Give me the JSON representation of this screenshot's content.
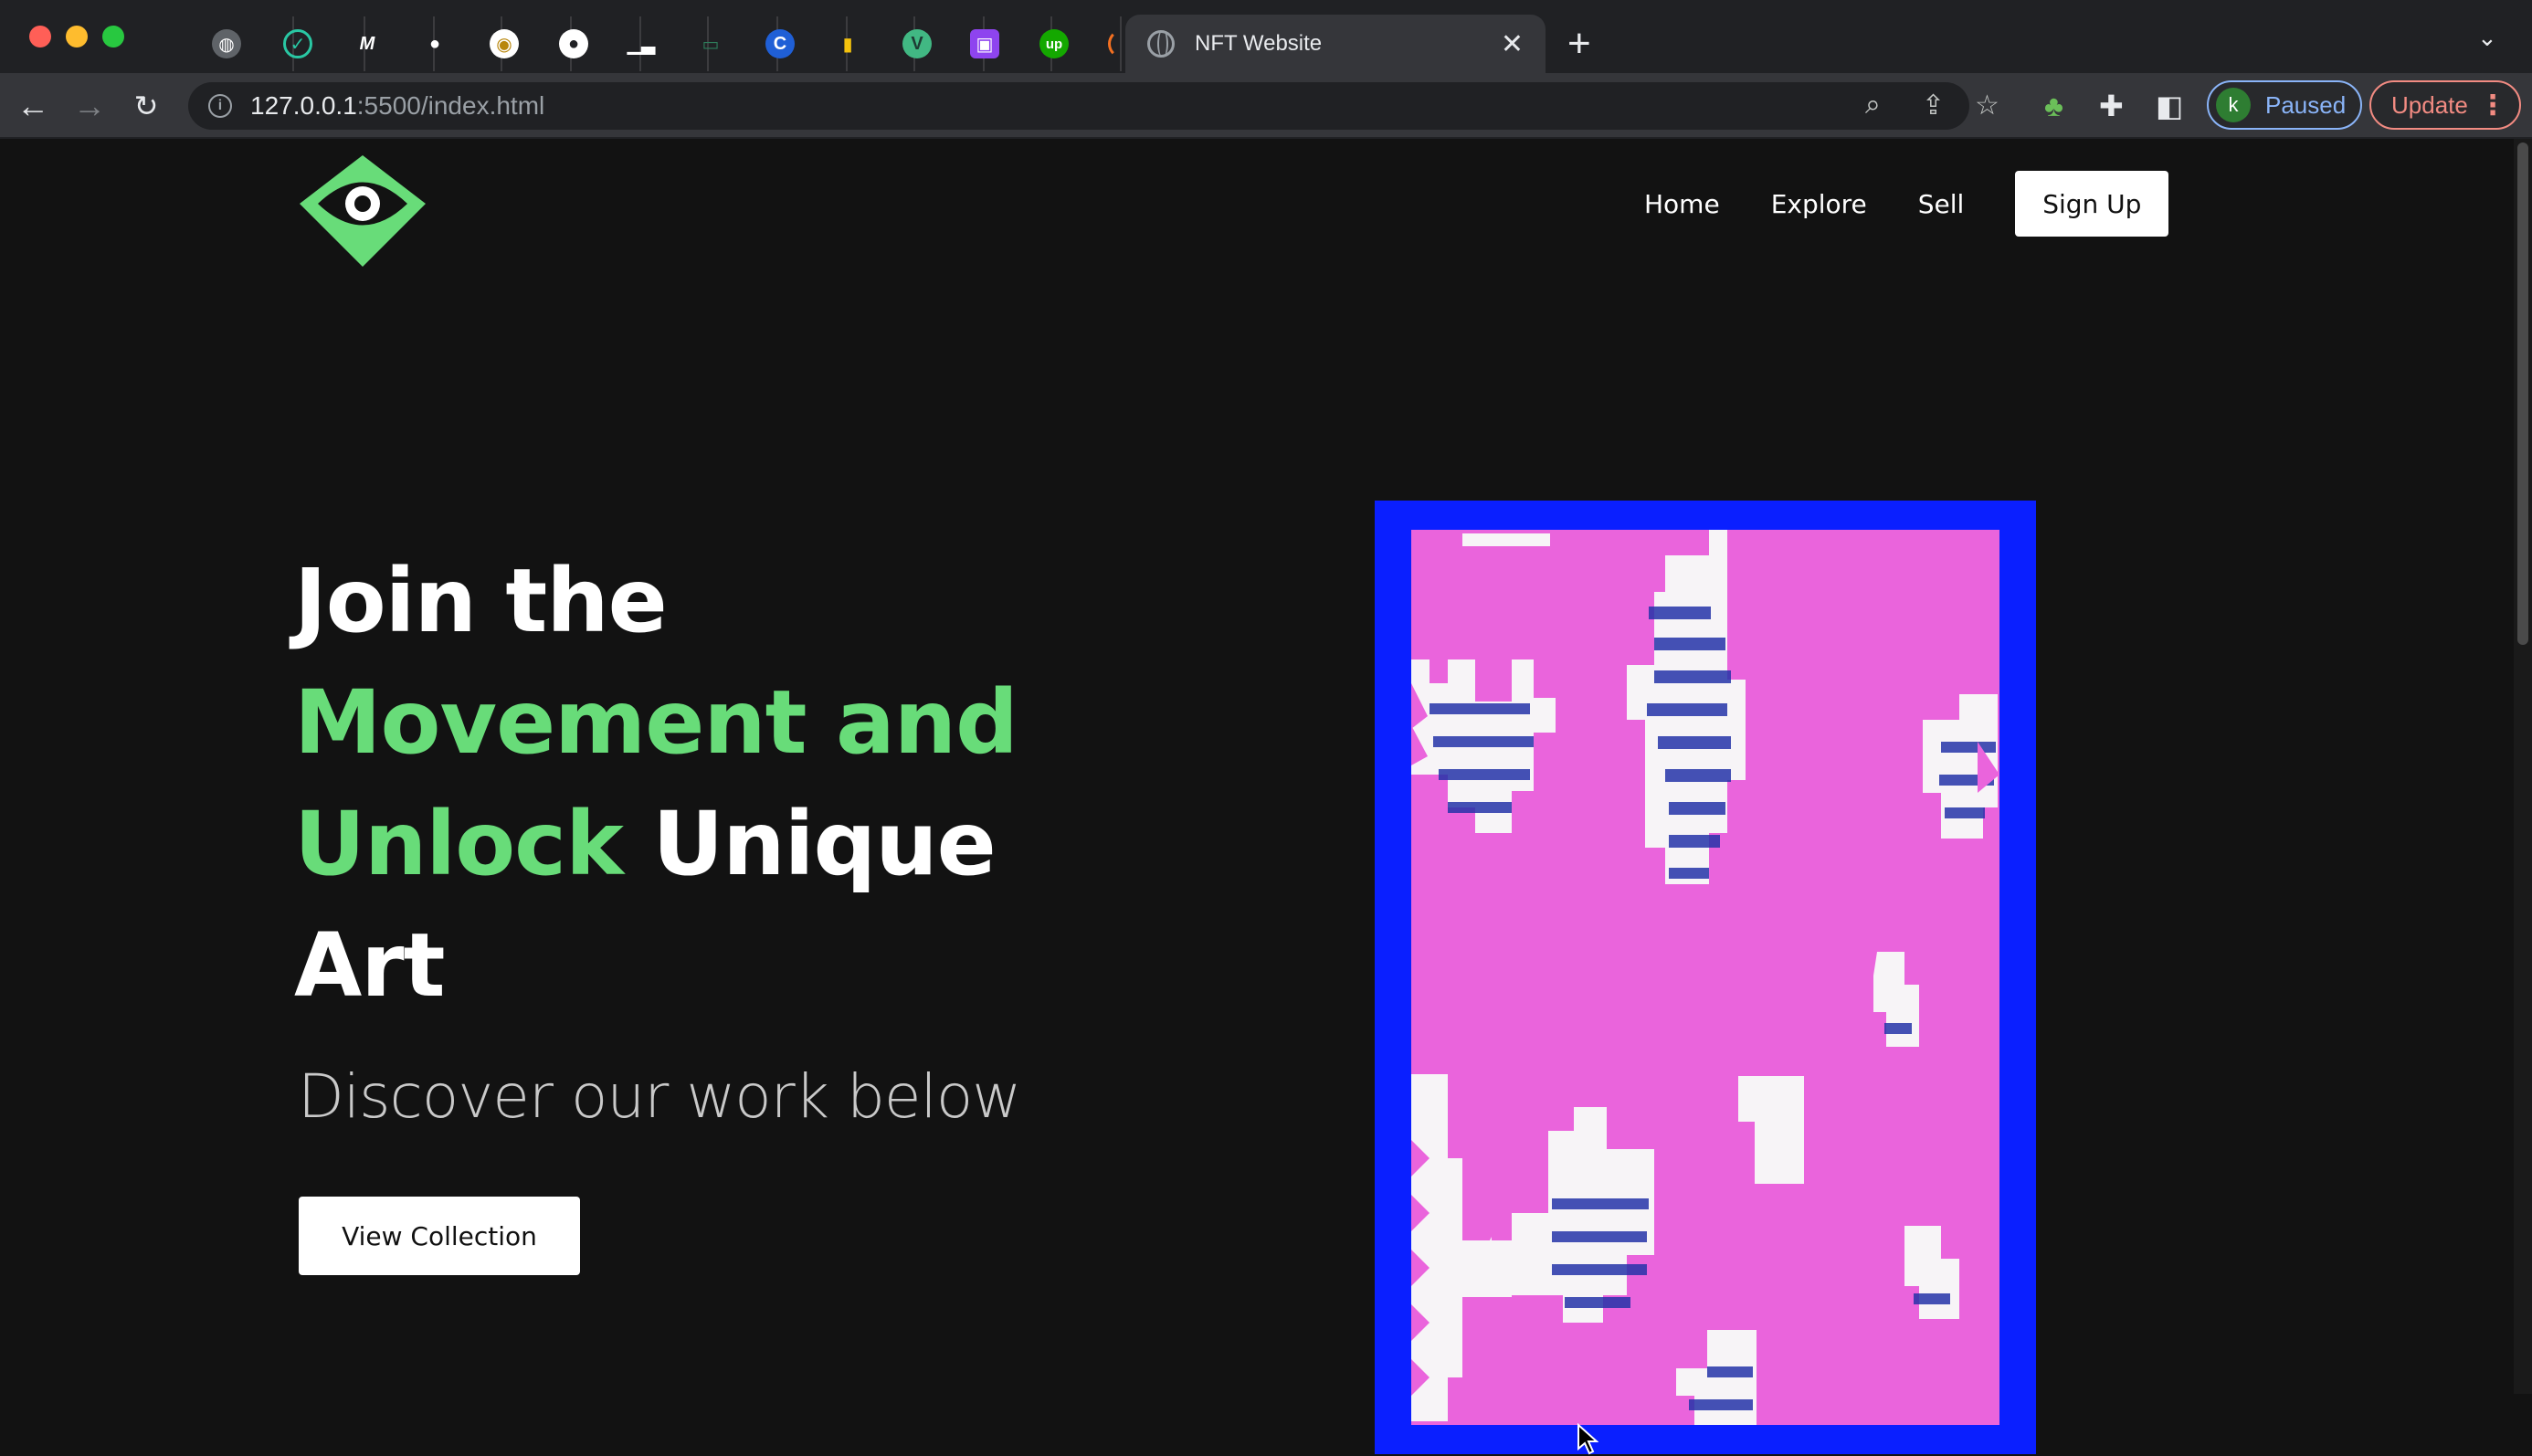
{
  "browser": {
    "tab_icons": [
      "globe-icon",
      "check-icon",
      "m-logo-icon",
      "cat-icon",
      "badge-icon",
      "github-icon",
      "chart-icon",
      "terminal-icon",
      "c-logo-icon",
      "battery-icon",
      "vue-icon",
      "user-card-icon",
      "upwork-icon",
      "loader-icon"
    ],
    "active_tab_title": "NFT Website",
    "url_host": "127.0.0.1",
    "url_path": ":5500/index.html",
    "profile_initial": "k",
    "profile_status": "Paused",
    "update_label": "Update"
  },
  "nav": {
    "links": [
      "Home",
      "Explore",
      "Sell"
    ],
    "signup_label": "Sign Up"
  },
  "hero": {
    "title_part1": "Join the ",
    "title_accent1": "Movement and Unlock",
    "title_part2": " Unique Art",
    "subtitle": "Discover our work below",
    "cta_label": "View Collection"
  },
  "colors": {
    "background": "#121212",
    "accent_green": "#68dc79",
    "art_frame_blue": "#0a1fff",
    "art_pink": "#ea64dc",
    "art_white": "#f7f4f7",
    "art_dark_blue": "#2432a8"
  }
}
